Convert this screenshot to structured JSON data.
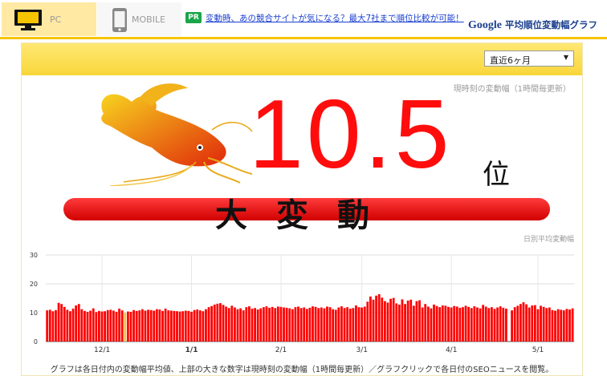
{
  "tabs": {
    "pc_label": "PC",
    "mobile_label": "MOBILE"
  },
  "pr": {
    "badge": "PR",
    "link_text": "変動時、あの競合サイトが気になる？最大7社まで順位比較が可能！"
  },
  "brand": {
    "google": "Google",
    "title": " 平均順位変動幅グラフ"
  },
  "period_select": {
    "value": "直近6ヶ月"
  },
  "current": {
    "label": "現時刻の変動幅（1時間毎更新）",
    "value": "10.5",
    "unit": "位"
  },
  "level_text": "大変動",
  "daily_label": "日別平均変動幅",
  "caption": "グラフは各日付内の変動幅平均値、上部の大きな数字は現時刻の変動幅（1時間毎更新）／グラフクリックで各日付のSEOニュースを閲覧。",
  "colors": {
    "bar": "#ff0000",
    "highlight": "#ffbf40",
    "accent": "#f5c400"
  },
  "chart_data": {
    "type": "bar",
    "ylim": [
      0,
      30
    ],
    "yticks": [
      "0",
      "10",
      "20",
      "30"
    ],
    "xticks": [
      {
        "label": "12/1",
        "index": 19,
        "bold": false
      },
      {
        "label": "1/1",
        "index": 50,
        "bold": true
      },
      {
        "label": "2/1",
        "index": 81,
        "bold": false
      },
      {
        "label": "3/1",
        "index": 109,
        "bold": false
      },
      {
        "label": "4/1",
        "index": 140,
        "bold": false
      },
      {
        "label": "5/1",
        "index": 170,
        "bold": false
      }
    ],
    "highlight_index": 27,
    "values": [
      10.8,
      11.0,
      10.5,
      10.9,
      13.4,
      13.0,
      12.0,
      11.0,
      10.5,
      11.4,
      12.5,
      13.0,
      11.2,
      10.6,
      10.3,
      10.7,
      11.5,
      10.2,
      10.6,
      10.4,
      10.5,
      10.9,
      11.0,
      10.7,
      10.3,
      11.4,
      10.8,
      9.9,
      10.4,
      10.3,
      10.9,
      10.6,
      10.8,
      11.2,
      10.7,
      11.0,
      10.9,
      10.7,
      11.2,
      11.1,
      10.6,
      11.4,
      10.8,
      10.7,
      10.6,
      10.5,
      10.4,
      10.5,
      10.7,
      10.6,
      10.3,
      10.9,
      11.1,
      10.8,
      10.5,
      11.2,
      11.9,
      12.3,
      12.8,
      13.1,
      13.3,
      12.7,
      12.1,
      11.6,
      12.4,
      11.8,
      11.2,
      11.5,
      10.8,
      11.9,
      12.2,
      11.4,
      11.6,
      11.1,
      11.5,
      11.9,
      12.2,
      11.7,
      12.0,
      11.6,
      12.1,
      12.0,
      11.8,
      11.7,
      11.5,
      11.2,
      11.9,
      12.1,
      11.6,
      11.8,
      11.3,
      11.7,
      12.2,
      12.0,
      11.6,
      11.8,
      11.5,
      12.1,
      11.9,
      11.2,
      11.0,
      11.8,
      12.2,
      11.6,
      11.9,
      11.4,
      11.6,
      12.5,
      11.9,
      11.8,
      12.1,
      13.8,
      15.6,
      14.5,
      15.9,
      16.4,
      15.2,
      14.0,
      13.5,
      14.8,
      15.1,
      13.2,
      12.8,
      14.6,
      13.0,
      14.2,
      14.5,
      12.4,
      14.0,
      14.3,
      11.8,
      13.0,
      12.1,
      11.5,
      12.8,
      12.3,
      11.9,
      12.5,
      12.4,
      12.0,
      11.8,
      12.3,
      12.1,
      11.7,
      11.9,
      12.4,
      12.0,
      11.6,
      12.2,
      11.8,
      11.5,
      12.7,
      12.1,
      11.6,
      11.9,
      11.3,
      11.8,
      12.2,
      11.7,
      11.4,
      0,
      10.8,
      11.9,
      12.4,
      13.0,
      13.6,
      12.9,
      11.8,
      12.5,
      12.6,
      11.2,
      12.4,
      12.0,
      11.6,
      11.8,
      10.9,
      10.7,
      11.2,
      11.0,
      10.8,
      11.3,
      11.1,
      11.5
    ]
  }
}
